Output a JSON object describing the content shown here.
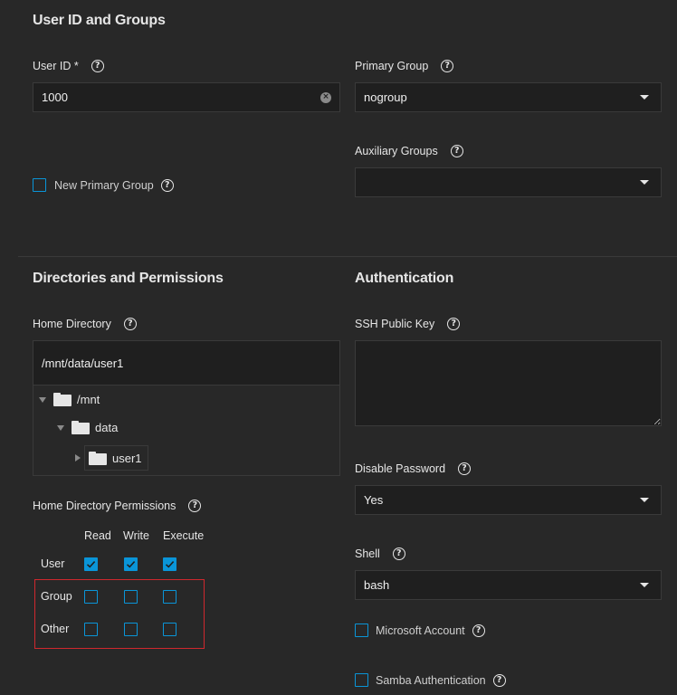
{
  "sections": {
    "user_id_groups": "User ID and Groups",
    "directories": "Directories and Permissions",
    "authentication": "Authentication"
  },
  "user_id": {
    "label": "User ID *",
    "value": "1000"
  },
  "primary_group": {
    "label": "Primary Group",
    "value": "nogroup"
  },
  "auxiliary_groups": {
    "label": "Auxiliary Groups",
    "value": ""
  },
  "new_primary_group": {
    "label": "New Primary Group",
    "checked": false
  },
  "home_directory": {
    "label": "Home Directory",
    "value": "/mnt/data/user1",
    "tree": [
      {
        "name": "/mnt",
        "expanded": true
      },
      {
        "name": "data",
        "expanded": true
      },
      {
        "name": "user1",
        "expanded": false
      }
    ]
  },
  "permissions": {
    "label": "Home Directory Permissions",
    "columns": [
      "Read",
      "Write",
      "Execute"
    ],
    "rows": [
      {
        "name": "User",
        "values": [
          true,
          true,
          true
        ]
      },
      {
        "name": "Group",
        "values": [
          false,
          false,
          false
        ]
      },
      {
        "name": "Other",
        "values": [
          false,
          false,
          false
        ]
      }
    ]
  },
  "ssh_key": {
    "label": "SSH Public Key",
    "value": ""
  },
  "disable_password": {
    "label": "Disable Password",
    "value": "Yes"
  },
  "shell": {
    "label": "Shell",
    "value": "bash"
  },
  "microsoft_account": {
    "label": "Microsoft Account",
    "checked": false
  },
  "samba_auth": {
    "label": "Samba Authentication",
    "checked": false
  },
  "colors": {
    "background": "#282828",
    "accent": "#0a95d8",
    "highlight": "#d0282e"
  }
}
